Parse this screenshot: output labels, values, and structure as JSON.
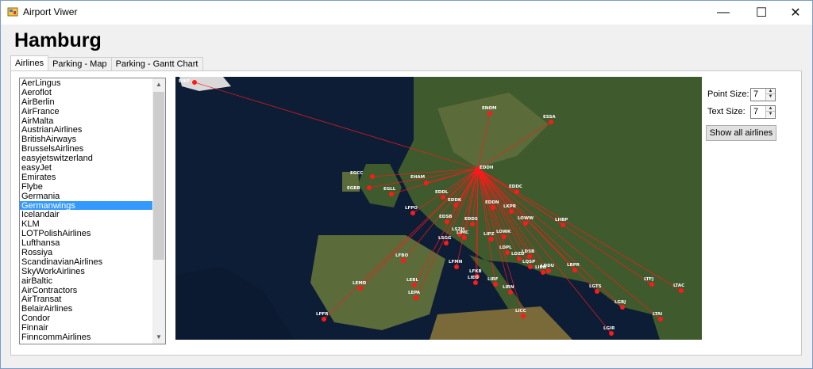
{
  "window": {
    "title": "Airport Viwer",
    "controls": {
      "minimize": "—",
      "maximize": "☐",
      "close": "✕"
    }
  },
  "header": {
    "city": "Hamburg"
  },
  "tabs": [
    {
      "label": "Airlines",
      "active": true
    },
    {
      "label": "Parking - Map",
      "active": false
    },
    {
      "label": "Parking - Gantt Chart",
      "active": false
    }
  ],
  "airlines": {
    "selected": "Germanwings",
    "items": [
      "AerLingus",
      "Aeroflot",
      "AirBerlin",
      "AirFrance",
      "AirMalta",
      "AustrianAirlines",
      "BritishAirways",
      "BrusselsAirlines",
      "easyjetswitzerland",
      "easyJet",
      "Emirates",
      "Flybe",
      "Germania",
      "Germanwings",
      "Icelandair",
      "KLM",
      "LOTPolishAirlines",
      "Lufthansa",
      "Rossiya",
      "ScandinavianAirlines",
      "SkyWorkAirlines",
      "airBaltic",
      "AirContractors",
      "AirTransat",
      "BelairAirlines",
      "Condor",
      "Finnair",
      "FinncommAirlines"
    ]
  },
  "controls": {
    "point_size_label": "Point Size:",
    "point_size_value": "7",
    "text_size_label": "Text Size:",
    "text_size_value": "7",
    "show_all_label": "Show all airlines"
  },
  "map": {
    "hub": "EDDH",
    "route_color": "#ff1a1a",
    "airports": [
      "BIKF",
      "ENOM",
      "ESSA",
      "EGCC",
      "EHAM",
      "EGBB",
      "EGLL",
      "EDDC",
      "EDDL",
      "EDDK",
      "EDDN",
      "LKPR",
      "LFPO",
      "EDSB",
      "EDDS",
      "LOWW",
      "LHBP",
      "LSZH",
      "LIPZ",
      "LSGG",
      "LIMC",
      "LOWK",
      "LDPL",
      "LFBO",
      "LFMN",
      "LDZD",
      "LQSP",
      "LDSB",
      "LIBD",
      "LDDU",
      "LFKB",
      "LIEO",
      "LIRF",
      "LEBL",
      "LBPR",
      "LEMD",
      "LIRN",
      "LEPA",
      "LGTS",
      "LTFJ",
      "LTAC",
      "LPFR",
      "LICC",
      "LGBJ",
      "LTAI",
      "LGIR"
    ]
  }
}
